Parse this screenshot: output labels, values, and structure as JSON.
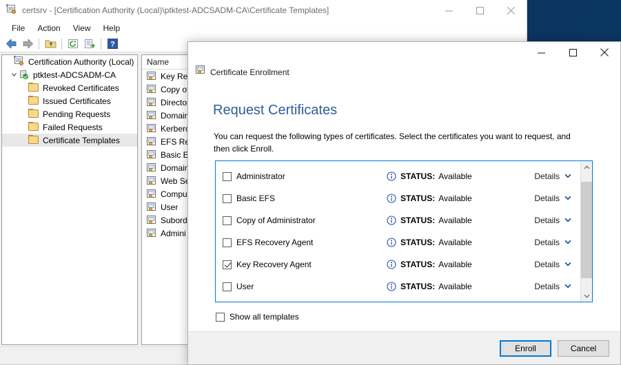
{
  "desktop": {
    "background_color": "#0b3a66"
  },
  "mmc_window": {
    "title": "certsrv - [Certification Authority (Local)\\ptktest-ADCSADM-CA\\Certificate Templates]",
    "title_icon": "certification-authority-icon",
    "window_controls": [
      {
        "name": "minimize",
        "glyph": "minimize-icon"
      },
      {
        "name": "maximize",
        "glyph": "maximize-icon"
      },
      {
        "name": "close",
        "glyph": "close-icon"
      }
    ],
    "menus": [
      "File",
      "Action",
      "View",
      "Help"
    ],
    "toolbar": [
      {
        "name": "back-button",
        "icon": "back-arrow-icon"
      },
      {
        "name": "forward-button",
        "icon": "forward-arrow-icon"
      },
      {
        "name": "up-one-level-button",
        "icon": "folder-up-icon"
      },
      {
        "name": "refresh-button",
        "icon": "refresh-icon"
      },
      {
        "name": "export-list-button",
        "icon": "export-list-icon"
      },
      {
        "name": "help-button",
        "icon": "help-icon"
      }
    ],
    "tree": [
      {
        "label": "Certification Authority (Local)",
        "level": 1,
        "icon": "certification-authority-icon",
        "expander": "",
        "selected": false
      },
      {
        "label": "ptktest-ADCSADM-CA",
        "level": 2,
        "icon": "ca-server-icon",
        "expander": "expanded",
        "selected": false
      },
      {
        "label": "Revoked Certificates",
        "level": 3,
        "icon": "folder-icon",
        "expander": "",
        "selected": false
      },
      {
        "label": "Issued Certificates",
        "level": 3,
        "icon": "folder-icon",
        "expander": "",
        "selected": false
      },
      {
        "label": "Pending Requests",
        "level": 3,
        "icon": "folder-icon",
        "expander": "",
        "selected": false
      },
      {
        "label": "Failed Requests",
        "level": 3,
        "icon": "folder-icon",
        "expander": "",
        "selected": false
      },
      {
        "label": "Certificate Templates",
        "level": 3,
        "icon": "folder-icon",
        "expander": "",
        "selected": true
      }
    ],
    "list_header": "Name",
    "list_items": [
      "Key Rec",
      "Copy of",
      "Director",
      "Domain",
      "Kerbero",
      "EFS Rec",
      "Basic EF",
      "Domain",
      "Web Se",
      "Compu",
      "User",
      "Subordi",
      "Admini"
    ],
    "status_text": ""
  },
  "dialog": {
    "window_controls": [
      {
        "name": "minimize",
        "glyph": "minimize-icon"
      },
      {
        "name": "maximize",
        "glyph": "maximize-icon"
      },
      {
        "name": "close",
        "glyph": "close-icon"
      }
    ],
    "header_title": "Certificate Enrollment",
    "header_icon": "certificate-icon",
    "heading": "Request Certificates",
    "description": "You can request the following types of certificates. Select the certificates you want to request, and then click Enroll.",
    "certificates": [
      {
        "name": "Administrator",
        "checked": false,
        "status_label": "STATUS:",
        "status_value": "Available",
        "details_label": "Details"
      },
      {
        "name": "Basic EFS",
        "checked": false,
        "status_label": "STATUS:",
        "status_value": "Available",
        "details_label": "Details"
      },
      {
        "name": "Copy of Administrator",
        "checked": false,
        "status_label": "STATUS:",
        "status_value": "Available",
        "details_label": "Details"
      },
      {
        "name": "EFS Recovery Agent",
        "checked": false,
        "status_label": "STATUS:",
        "status_value": "Available",
        "details_label": "Details"
      },
      {
        "name": "Key Recovery Agent",
        "checked": true,
        "status_label": "STATUS:",
        "status_value": "Available",
        "details_label": "Details"
      },
      {
        "name": "User",
        "checked": false,
        "status_label": "STATUS:",
        "status_value": "Available",
        "details_label": "Details"
      }
    ],
    "show_all_templates": {
      "label": "Show all templates",
      "checked": false
    },
    "buttons": {
      "enroll": "Enroll",
      "cancel": "Cancel"
    },
    "accent_color": "#0078d7",
    "heading_color": "#2f5d99"
  }
}
